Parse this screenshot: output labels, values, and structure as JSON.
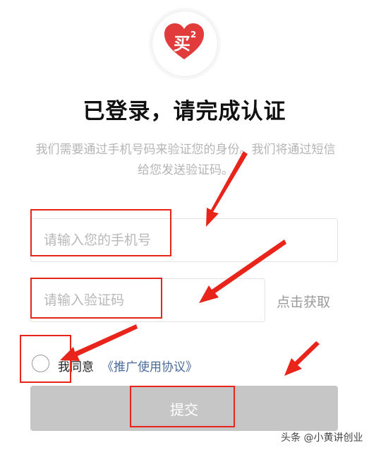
{
  "logo": {
    "text": "买",
    "superscript": "2",
    "color": "#e23b3b"
  },
  "title": "已登录，请完成认证",
  "description": "我们需要通过手机号码来验证您的身份。我们将通过短信给您发送验证码。",
  "phone": {
    "placeholder": "请输入您的手机号",
    "value": ""
  },
  "code": {
    "placeholder": "请输入验证码",
    "value": "",
    "get_code_label": "点击获取"
  },
  "agreement": {
    "prefix": "我同意",
    "link": "《推广使用协议》",
    "checked": false
  },
  "submit_label": "提交",
  "watermark": "头条 @小黄讲创业",
  "colors": {
    "annotation": "#e8241b",
    "link": "#4a6a9c",
    "button_disabled": "#c6c6c6"
  }
}
